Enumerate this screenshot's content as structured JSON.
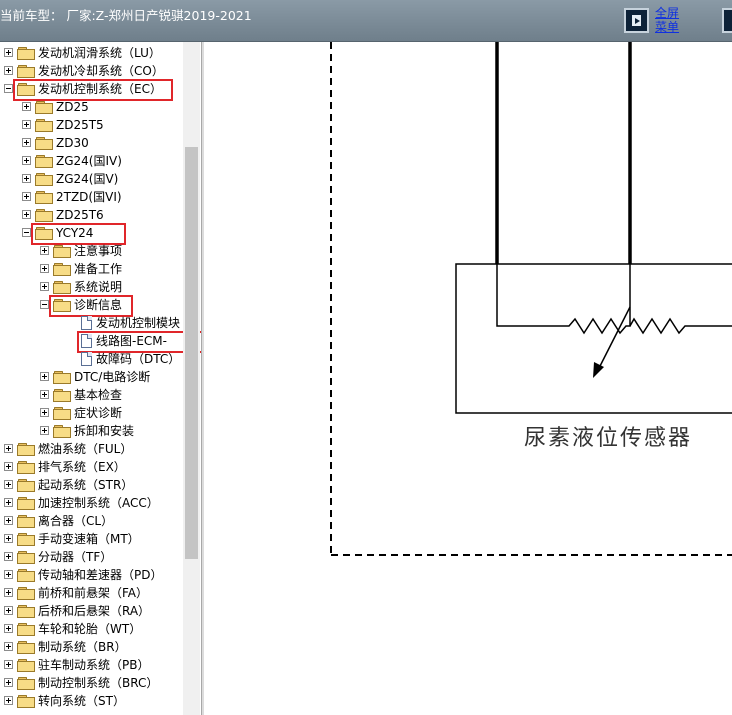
{
  "header": {
    "title": "当前车型：  厂家:Z-郑州日产锐骐2019-2021",
    "fullscreen_line1": "全屏",
    "fullscreen_line2": "菜单"
  },
  "tree": [
    {
      "label": "发动机润滑系统（LU）",
      "level": 0,
      "node": "folder",
      "expander": "plus"
    },
    {
      "label": "发动机冷却系统（CO）",
      "level": 0,
      "node": "folder",
      "expander": "plus"
    },
    {
      "label": "发动机控制系统（EC）",
      "level": 0,
      "node": "folder-open",
      "expander": "minus",
      "highlighted": true
    },
    {
      "label": "ZD25",
      "level": 1,
      "node": "folder",
      "expander": "plus"
    },
    {
      "label": "ZD25T5",
      "level": 1,
      "node": "folder",
      "expander": "plus"
    },
    {
      "label": "ZD30",
      "level": 1,
      "node": "folder",
      "expander": "plus"
    },
    {
      "label": "ZG24(国IV)",
      "level": 1,
      "node": "folder",
      "expander": "plus"
    },
    {
      "label": "ZG24(国V)",
      "level": 1,
      "node": "folder",
      "expander": "plus"
    },
    {
      "label": "2TZD(国VI)",
      "level": 1,
      "node": "folder",
      "expander": "plus"
    },
    {
      "label": "ZD25T6",
      "level": 1,
      "node": "folder",
      "expander": "plus"
    },
    {
      "label": "YCY24",
      "level": 1,
      "node": "folder-open",
      "expander": "minus",
      "highlighted": true
    },
    {
      "label": "注意事项",
      "level": 2,
      "node": "folder",
      "expander": "plus"
    },
    {
      "label": "准备工作",
      "level": 2,
      "node": "folder",
      "expander": "plus"
    },
    {
      "label": "系统说明",
      "level": 2,
      "node": "folder",
      "expander": "plus"
    },
    {
      "label": "诊断信息",
      "level": 2,
      "node": "folder-open",
      "expander": "minus",
      "highlighted": true
    },
    {
      "label": "发动机控制模块",
      "level": 3,
      "node": "doc",
      "expander": "none"
    },
    {
      "label": "线路图-ECM-",
      "level": 3,
      "node": "doc",
      "expander": "none",
      "highlighted": true
    },
    {
      "label": "故障码（DTC）",
      "level": 3,
      "node": "doc",
      "expander": "none"
    },
    {
      "label": "DTC/电路诊断",
      "level": 2,
      "node": "folder",
      "expander": "plus"
    },
    {
      "label": "基本检查",
      "level": 2,
      "node": "folder",
      "expander": "plus"
    },
    {
      "label": "症状诊断",
      "level": 2,
      "node": "folder",
      "expander": "plus"
    },
    {
      "label": "拆卸和安装",
      "level": 2,
      "node": "folder",
      "expander": "plus"
    },
    {
      "label": "燃油系统（FUL）",
      "level": 0,
      "node": "folder",
      "expander": "plus"
    },
    {
      "label": "排气系统（EX）",
      "level": 0,
      "node": "folder",
      "expander": "plus"
    },
    {
      "label": "起动系统（STR）",
      "level": 0,
      "node": "folder",
      "expander": "plus"
    },
    {
      "label": "加速控制系统（ACC）",
      "level": 0,
      "node": "folder",
      "expander": "plus"
    },
    {
      "label": "离合器（CL）",
      "level": 0,
      "node": "folder",
      "expander": "plus"
    },
    {
      "label": "手动变速箱（MT）",
      "level": 0,
      "node": "folder",
      "expander": "plus"
    },
    {
      "label": "分动器（TF）",
      "level": 0,
      "node": "folder",
      "expander": "plus"
    },
    {
      "label": "传动轴和差速器（PD）",
      "level": 0,
      "node": "folder",
      "expander": "plus"
    },
    {
      "label": "前桥和前悬架（FA）",
      "level": 0,
      "node": "folder",
      "expander": "plus"
    },
    {
      "label": "后桥和后悬架（RA）",
      "level": 0,
      "node": "folder",
      "expander": "plus"
    },
    {
      "label": "车轮和轮胎（WT）",
      "level": 0,
      "node": "folder",
      "expander": "plus"
    },
    {
      "label": "制动系统（BR）",
      "level": 0,
      "node": "folder",
      "expander": "plus"
    },
    {
      "label": "驻车制动系统（PB）",
      "level": 0,
      "node": "folder",
      "expander": "plus"
    },
    {
      "label": "制动控制系统（BRC）",
      "level": 0,
      "node": "folder",
      "expander": "plus"
    },
    {
      "label": "转向系统（ST）",
      "level": 0,
      "node": "folder",
      "expander": "plus"
    }
  ],
  "diagram": {
    "sensor_label": "尿素液位传感器"
  },
  "colors": {
    "highlight": "#e0262a",
    "link": "#1030e0",
    "folder": "#f7dc86"
  }
}
